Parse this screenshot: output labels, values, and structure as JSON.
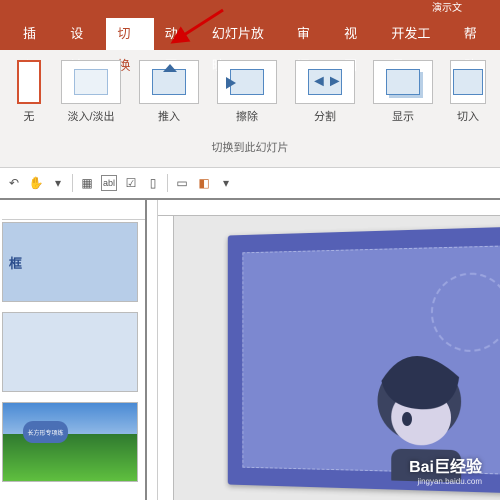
{
  "title_fragment": "演示文",
  "menu": {
    "insert": "插入",
    "design": "设计",
    "transitions": "切换",
    "animations": "动画",
    "slideshow": "幻灯片放映",
    "review": "审阅",
    "view": "视图",
    "developer": "开发工具",
    "help": "帮助"
  },
  "transitions_gallery": {
    "none": "无",
    "fade": "淡入/淡出",
    "push": "推入",
    "wipe": "擦除",
    "split": "分割",
    "reveal": "显示",
    "cut": "切入"
  },
  "ribbon_caption": "切换到此幻灯片",
  "thumbnails": {
    "slide1_text": "框",
    "slide3_bubble": "长方形专项练"
  },
  "watermark": {
    "brand": "Bai巨经验",
    "sub": "jingyan.baidu.com"
  }
}
